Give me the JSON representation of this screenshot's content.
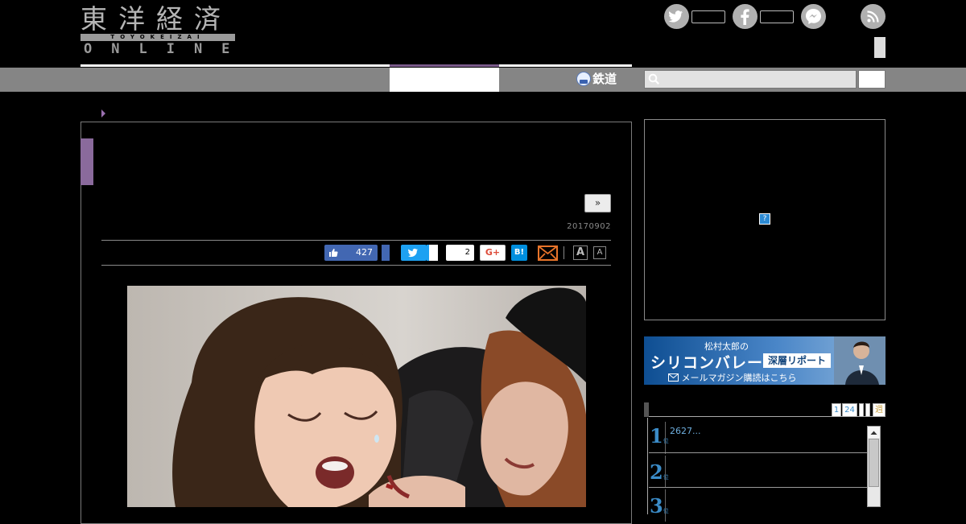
{
  "header": {
    "logo": {
      "kanji": "東洋経済",
      "romaji": "TOYOKEIZAI",
      "online": "ONLINE"
    },
    "social_icons": [
      "twitter-icon",
      "facebook-icon",
      "messenger-icon",
      "rss-icon"
    ]
  },
  "nav": {
    "rail_label": "鉄道",
    "search": {
      "placeholder": "",
      "value": ""
    }
  },
  "article": {
    "next_label": "»",
    "date": "20170902",
    "share": {
      "facebook_like_count": "427",
      "hatena_count": "2",
      "gplus_label": "G+",
      "hatena_label": "B!",
      "font_large": "A",
      "font_small": "A"
    }
  },
  "sidebar": {
    "ad_marker": "?",
    "banner": {
      "small_line": "松村太郎の",
      "main_line": "シリコンバレー",
      "tag": "深層リポート",
      "mail_line": "メールマガジン購読はこちら"
    },
    "ranking": {
      "tabs": [
        "1",
        "24",
        "",
        "",
        "週"
      ],
      "items": [
        {
          "rank": "1",
          "suffix": "位",
          "text": "2627..."
        },
        {
          "rank": "2",
          "suffix": "位",
          "text": ""
        },
        {
          "rank": "3",
          "suffix": "位",
          "text": ""
        }
      ]
    }
  },
  "colors": {
    "background": "#000000",
    "nav_gray": "#858585",
    "accent_purple": "#8a6a9c",
    "facebook": "#4267b2",
    "twitter": "#1da1f2",
    "hatena": "#008fde",
    "rank_blue": "#3b8cc8"
  }
}
